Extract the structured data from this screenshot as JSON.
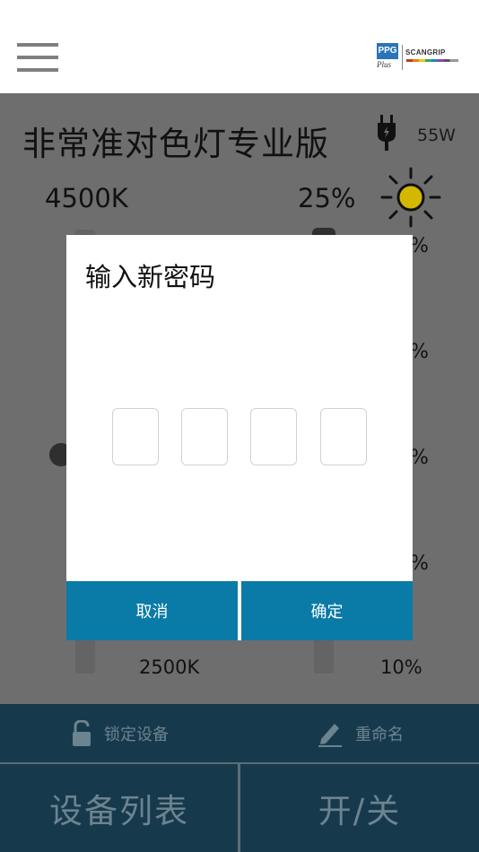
{
  "header": {
    "menu_icon": "hamburger-menu-icon",
    "brand": {
      "ppg": "PPG",
      "plus": "Plus",
      "scangrip": "SCANGRIP"
    }
  },
  "main": {
    "device_title": "非常准对色灯专业版",
    "power_icon": "plug-icon",
    "watt": "55W",
    "kelvin_top": "4500K",
    "brightness_top": "25%",
    "sun_icon": "sun-icon",
    "kelvin_bottom": "2500K",
    "brightness_bottom": "10%",
    "scale_pct_partial": [
      "%",
      "%",
      "%",
      "%"
    ]
  },
  "action_bar": {
    "lock_icon": "unlock-icon",
    "lock_label": "锁定设备",
    "rename_icon": "pencil-icon",
    "rename_label": "重命名"
  },
  "nav_bar": {
    "devices_label": "设备列表",
    "power_label": "开/关"
  },
  "dialog": {
    "title": "输入新密码",
    "pin_values": [
      "",
      "",
      "",
      ""
    ],
    "cancel_label": "取消",
    "confirm_label": "确定"
  },
  "colors": {
    "accent": "#0a7aa6",
    "bottom_bar": "#163a4c",
    "overlay_bg": "#6e6e6e",
    "sun": "#d4b800"
  }
}
